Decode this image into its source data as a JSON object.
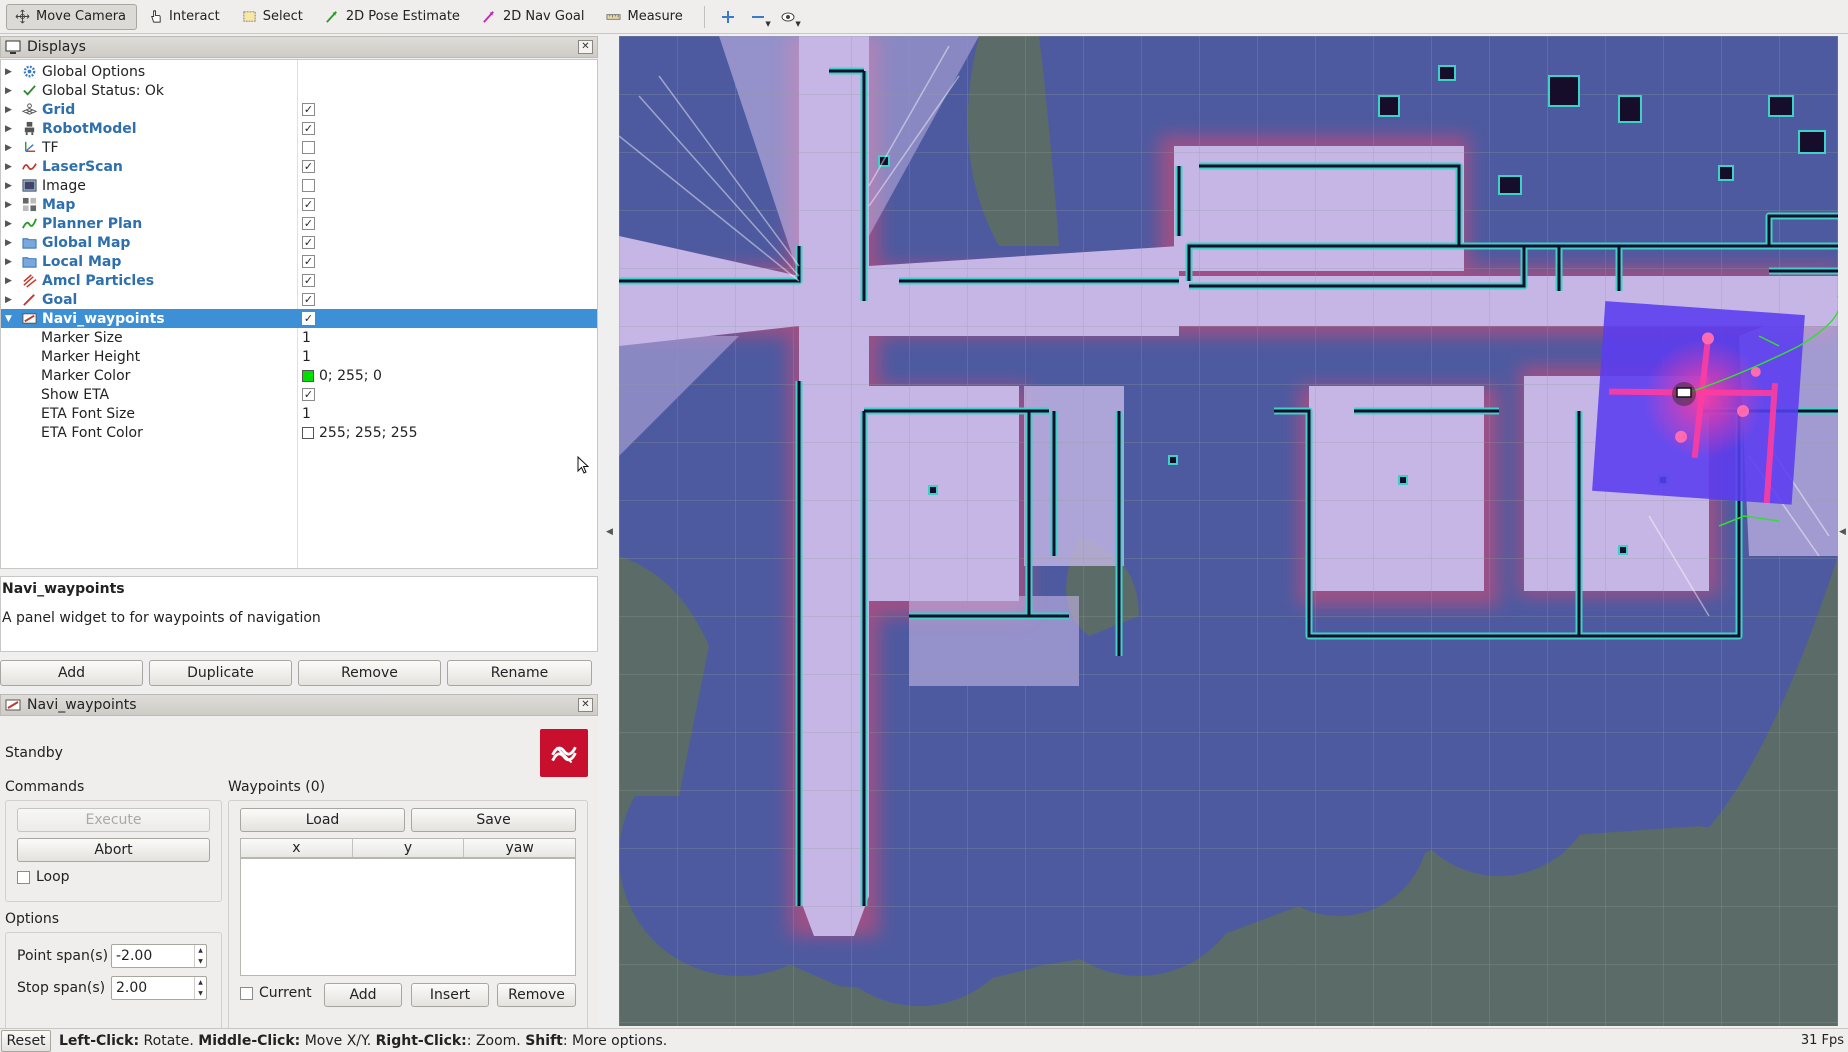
{
  "toolbar": {
    "tools": [
      {
        "label": "Move Camera",
        "icon": "move-camera-icon"
      },
      {
        "label": "Interact",
        "icon": "interact-icon"
      },
      {
        "label": "Select",
        "icon": "select-icon"
      },
      {
        "label": "2D Pose Estimate",
        "icon": "pose-estimate-icon"
      },
      {
        "label": "2D Nav Goal",
        "icon": "nav-goal-icon"
      },
      {
        "label": "Measure",
        "icon": "measure-icon"
      }
    ],
    "active_tool": "Move Camera"
  },
  "displays_panel": {
    "title": "Displays",
    "items": [
      {
        "label": "Global Options",
        "style": "normal",
        "checked": null,
        "icon": "gear-icon",
        "color": "#3a7bc8"
      },
      {
        "label": "Global Status: Ok",
        "style": "normal",
        "checked": null,
        "icon": "check-icon",
        "color": "#2f8a2f"
      },
      {
        "label": "Grid",
        "style": "blue",
        "checked": true,
        "icon": "grid-icon",
        "color": "#555555"
      },
      {
        "label": "RobotModel",
        "style": "blue",
        "checked": true,
        "icon": "robot-icon",
        "color": "#555555"
      },
      {
        "label": "TF",
        "style": "normal",
        "checked": false,
        "icon": "tf-axes-icon",
        "color": "#c0392b"
      },
      {
        "label": "LaserScan",
        "style": "blue",
        "checked": true,
        "icon": "laser-scan-icon",
        "color": "#c0392b"
      },
      {
        "label": "Image",
        "style": "normal",
        "checked": false,
        "icon": "image-icon",
        "color": "#555555"
      },
      {
        "label": "Map",
        "style": "blue",
        "checked": true,
        "icon": "map-icon",
        "color": "#555555"
      },
      {
        "label": "Planner Plan",
        "style": "blue",
        "checked": true,
        "icon": "path-icon",
        "color": "#2f9a2f"
      },
      {
        "label": "Global Map",
        "style": "blue",
        "checked": true,
        "icon": "folder-icon",
        "color": "#3a7bc8"
      },
      {
        "label": "Local Map",
        "style": "blue",
        "checked": true,
        "icon": "folder-icon",
        "color": "#3a7bc8"
      },
      {
        "label": "Amcl Particles",
        "style": "blue",
        "checked": true,
        "icon": "pose-array-icon",
        "color": "#c0392b"
      },
      {
        "label": "Goal",
        "style": "blue",
        "checked": true,
        "icon": "pose-icon",
        "color": "#c0392b"
      },
      {
        "label": "Navi_waypoints",
        "style": "blue",
        "checked": true,
        "icon": "waypoints-icon",
        "color": "#c0392b",
        "selected": true,
        "expanded": true
      }
    ],
    "properties": [
      {
        "label": "Marker Size",
        "value": "1",
        "type": "text"
      },
      {
        "label": "Marker Height",
        "value": "1",
        "type": "text"
      },
      {
        "label": "Marker Color",
        "value": "0; 255; 0",
        "type": "color",
        "swatch": "#00dd00"
      },
      {
        "label": "Show ETA",
        "value": "",
        "type": "checkbox",
        "checked": true
      },
      {
        "label": "ETA Font Size",
        "value": "1",
        "type": "text"
      },
      {
        "label": "ETA Font Color",
        "value": "255; 255; 255",
        "type": "color",
        "swatch": "#ffffff"
      }
    ],
    "description": {
      "title": "Navi_waypoints",
      "text": "A panel widget to for waypoints of navigation"
    },
    "buttons": {
      "add": "Add",
      "duplicate": "Duplicate",
      "remove": "Remove",
      "rename": "Rename"
    }
  },
  "navi_panel": {
    "title": "Navi_waypoints",
    "status": "Standby",
    "commands": {
      "title": "Commands",
      "execute": "Execute",
      "abort": "Abort",
      "loop": "Loop",
      "loop_checked": false
    },
    "options": {
      "title": "Options",
      "point_span_label": "Point span(s)",
      "point_span_value": "-2.00",
      "stop_span_label": "Stop span(s)",
      "stop_span_value": "2.00"
    },
    "waypoints": {
      "title": "Waypoints (0)",
      "load": "Load",
      "save": "Save",
      "columns": [
        "x",
        "y",
        "yaw"
      ],
      "current": "Current",
      "current_checked": false,
      "add": "Add",
      "insert": "Insert",
      "remove": "Remove"
    }
  },
  "statusbar": {
    "reset": "Reset",
    "hint_parts": [
      {
        "text": "Left-Click:",
        "bold": true
      },
      {
        "text": " Rotate. ",
        "bold": false
      },
      {
        "text": "Middle-Click:",
        "bold": true
      },
      {
        "text": " Move X/Y. ",
        "bold": false
      },
      {
        "text": "Right-Click:",
        "bold": true
      },
      {
        "text": ": Zoom. ",
        "bold": false
      },
      {
        "text": "Shift",
        "bold": true
      },
      {
        "text": ": More options.",
        "bold": false
      }
    ],
    "fps": "31 Fps"
  },
  "colors": {
    "selection": "#3d8fd6",
    "map_unknown": "#5b6b68",
    "map_costmap": "#4d5aa0",
    "map_free": "#c6b6e6",
    "wall": "#160d2b",
    "wall_inflation": "#3fd0c8"
  }
}
